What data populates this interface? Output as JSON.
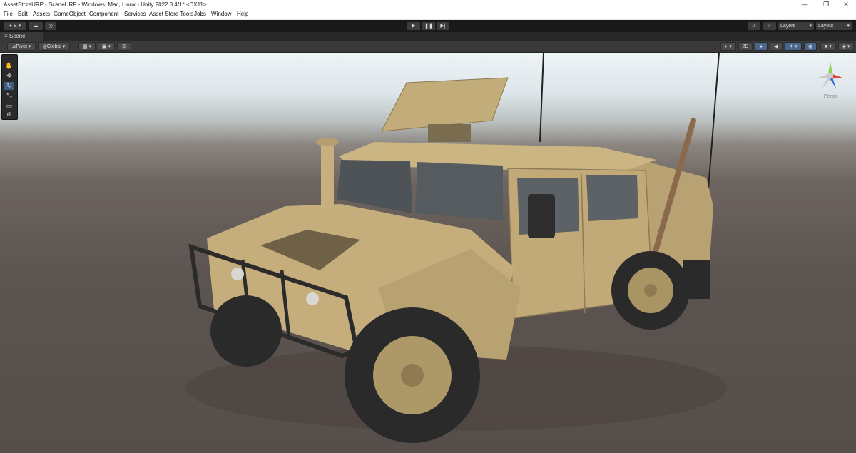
{
  "window": {
    "title": "AssetStoreURP - SceneURP - Windows, Mac, Linux - Unity 2022.3.4f1* <DX11>",
    "controls": [
      "—",
      "❐",
      "✕"
    ]
  },
  "menu": [
    "File",
    "Edit",
    "Assets",
    "GameObject",
    "Component",
    "Services",
    "Asset Store Tools",
    "Jobs",
    "Window",
    "Help"
  ],
  "toolbar": {
    "account_label": "E",
    "layers_label": "Layers",
    "layout_label": "Layout"
  },
  "tab": {
    "scene_label": "Scene"
  },
  "scene_toolbar": {
    "pivot_label": "Pivot",
    "global_label": "Global",
    "mode_2d_label": "2D"
  },
  "gizmo": {
    "label": "Persp"
  },
  "colors": {
    "accent": "#4b6790",
    "toolbar_bg": "#191919",
    "vehicle_tan": "#c9b27e"
  }
}
